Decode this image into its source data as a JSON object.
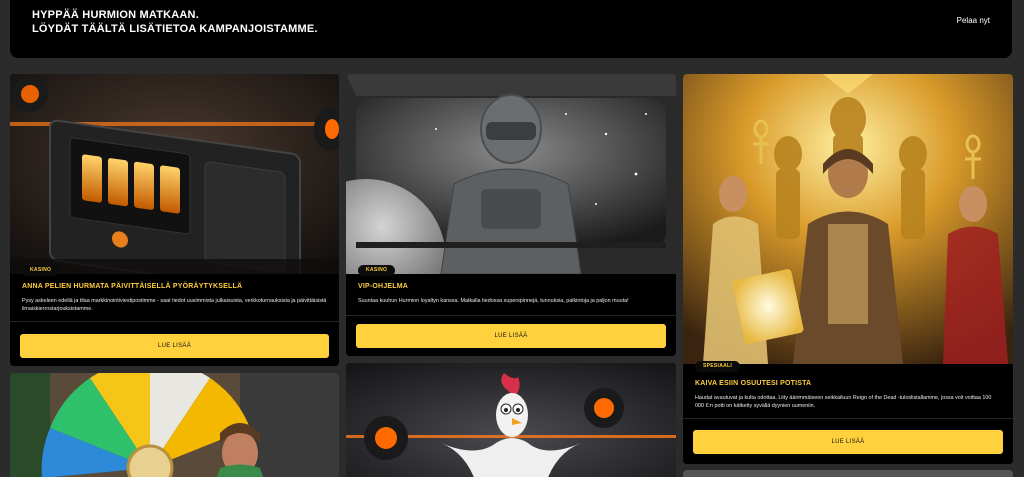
{
  "banner": {
    "title_line1": "HYPPÄÄ HURMION MATKAAN.",
    "title_line2": "LÖYDÄT TÄÄLTÄ LISÄTIETOA KAMPANJOISTAMME.",
    "cta": "Pelaa nyt"
  },
  "cards": [
    {
      "badge": "KASINO",
      "title": "ANNA PELIEN HURMATA PÄIVITTÄISELLÄ PYÖRÄYTYKSELLÄ",
      "description": "Pysy askeleen edellä ja tilaa markkinointiviestipostimme - saat tiedot uusimmista julkaisuista, verkkoturnauksista ja päivittäisistä ilmaiskierrostarjouksistamme.",
      "button": "LUE LISÄÄ"
    },
    {
      "badge": "KASINO",
      "title": "VIP-OHJELMA",
      "description": "Suuntaa kuuhun Hurmion loyaltyn kanssa. Matkalla tiedossa superspinnejä, tunnuksia, palkintoja ja paljon muuta!",
      "button": "LUE LISÄÄ"
    },
    {
      "badge": "SPESIAALI",
      "title": "KAIVA ESIIN OSUUTESI POTISTA",
      "description": "Haudat avautuvat ja kulta odottaa. Liity äärimmäiseen seikkailuun Reign of the Dead -tuloslistallamme, jossa voit voittaa 100 000 €:n potti on kätketty syvällä dyynien uumeniin.",
      "button": "LUE LISÄÄ"
    }
  ],
  "colors": {
    "accent": "#ffd23d",
    "title": "#ffcf3f",
    "background": "#2b2b2b",
    "card": "#000000"
  }
}
